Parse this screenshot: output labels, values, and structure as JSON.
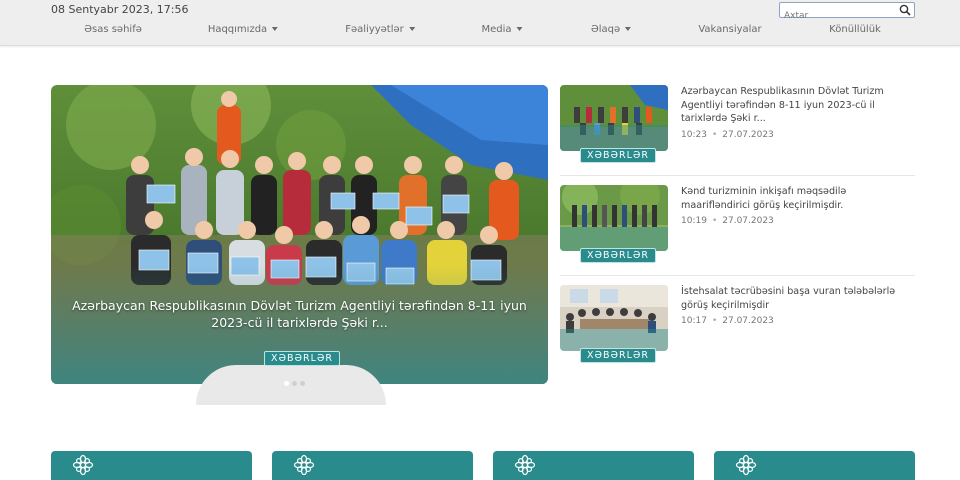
{
  "header": {
    "datetime": "08 Sentyabr 2023, 17:56",
    "search_placeholder": "Axtar"
  },
  "nav": {
    "items": [
      {
        "label": "Əsas səhifə",
        "dropdown": false
      },
      {
        "label": "Haqqımızda",
        "dropdown": true
      },
      {
        "label": "Fəaliyyətlər",
        "dropdown": true
      },
      {
        "label": "Media",
        "dropdown": true
      },
      {
        "label": "Əlaqə",
        "dropdown": true
      },
      {
        "label": "Vakansiyalar",
        "dropdown": false
      },
      {
        "label": "Könüllülük",
        "dropdown": false
      }
    ]
  },
  "hero": {
    "title": "Azərbaycan Respublikasının Dövlət Turizm Agentliyi tərəfindən 8-11 iyun 2023-cü il tarixlərdə Şəki r...",
    "badge": "XƏBƏRLƏR",
    "slide_count": 3,
    "active_slide": 1
  },
  "news": [
    {
      "title": "Azərbaycan Respublikasının Dövlət Turizm Agentliyi tərəfindən 8-11 iyun 2023-cü il tarixlərdə Şəki r...",
      "time": "10:23",
      "date": "27.07.2023",
      "badge": "XƏBƏRLƏR"
    },
    {
      "title": "Kənd turizminin inkişafı məqsədilə maarifləndirici görüş keçirilmişdir.",
      "time": "10:19",
      "date": "27.07.2023",
      "badge": "XƏBƏRLƏR"
    },
    {
      "title": "İstehsalat təcrübəsini başa vuran tələbələrlə görüş keçirilmişdir",
      "time": "10:17",
      "date": "27.07.2023",
      "badge": "XƏBƏRLƏR"
    }
  ],
  "colors": {
    "accent": "#2a8b8d",
    "topbar": "#eeeeee"
  },
  "icons": {
    "search": "search-icon",
    "card": "flower-icon"
  }
}
